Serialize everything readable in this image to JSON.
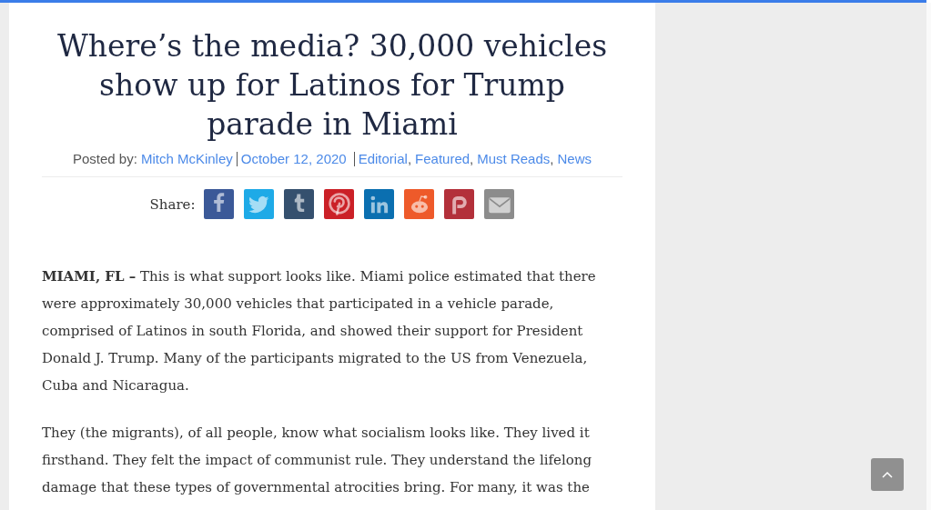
{
  "article": {
    "title": "Where’s the media? 30,000 vehicles show up for Latinos for Trump parade in Miami",
    "byline": {
      "label": "Posted by:",
      "author": "Mitch McKinley",
      "date": "October 12, 2020",
      "categories": [
        "Editorial",
        "Featured",
        "Must Reads",
        "News"
      ],
      "category_separators": [
        ",",
        ",",
        ","
      ]
    },
    "share": {
      "label": "Share:",
      "buttons": [
        {
          "kind": "facebook",
          "color": "#3b5998"
        },
        {
          "kind": "twitter",
          "color": "#1eaae7"
        },
        {
          "kind": "tumblr",
          "color": "#35506e"
        },
        {
          "kind": "pinterest",
          "color": "#cb2027"
        },
        {
          "kind": "linkedin",
          "color": "#0b6fb0"
        },
        {
          "kind": "reddit",
          "color": "#ee5a2a"
        },
        {
          "kind": "parler",
          "color": "#b3303a"
        },
        {
          "kind": "email",
          "color": "#8c8c8c"
        }
      ]
    },
    "paragraphs": [
      "**MIAMI, FL –** This is what support looks like.  Miami police estimated that there were approximately 30,000 vehicles that participated in a vehicle parade, comprised of  Latinos in south Florida,  and showed their support for President Donald J. Trump.  Many of the participants migrated to the US from Venezuela, Cuba and Nicaragua.",
      "They (the migrants), of all people, know what socialism looks like.  They lived it firsthand.  They felt the impact of communist rule. They understand the lifelong damage that these types of governmental atrocities bring.  For many, it was the"
    ]
  },
  "scroll_top": {
    "kind": "chevron"
  }
}
